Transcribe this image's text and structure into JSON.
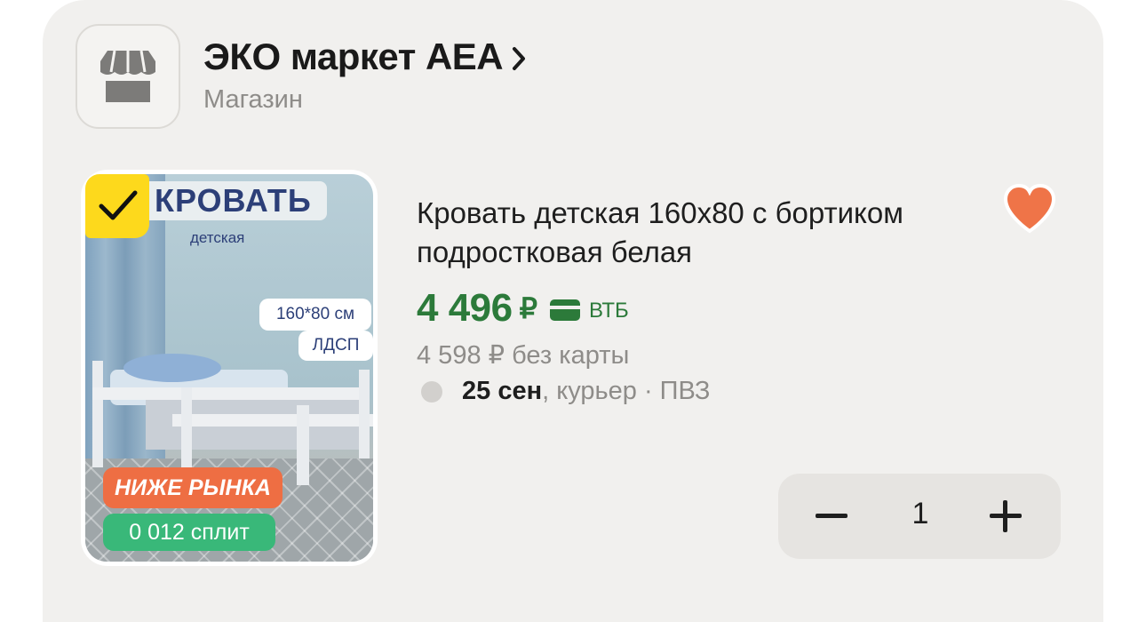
{
  "shop": {
    "name": "ЭКО маркет АЕА",
    "type": "Магазин",
    "logo_icon": "storefront-icon"
  },
  "product": {
    "title": "Кровать детская 160х80 с бортиком подростковая белая",
    "image": {
      "banner_title": "КРОВАТЬ",
      "banner_subtitle": "детская",
      "size_tag": "160*80 см",
      "material_tag": "ЛДСП",
      "badge_below_market": "НИЖЕ РЫНКА",
      "badge_split": "0 012 сплит",
      "selected_icon": "check-icon"
    },
    "price": {
      "amount": "4 496",
      "currency": "₽",
      "bank": "ВТБ",
      "card_icon": "bank-card-icon",
      "old": "4 598 ₽ без карты"
    },
    "delivery": {
      "date": "25 сен",
      "methods": ", курьер · ПВЗ"
    },
    "favorite_icon": "heart-icon"
  },
  "cart": {
    "quantity": "1"
  },
  "colors": {
    "price_green": "#2c7a3a",
    "heart": "#ef7448",
    "badge_yellow": "#fdd91c",
    "badge_orange": "#ee6e43",
    "badge_green": "#39b879"
  }
}
